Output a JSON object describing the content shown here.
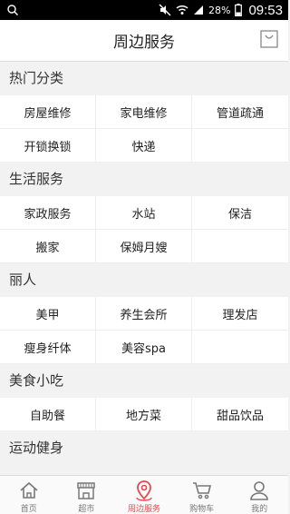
{
  "status_bar": {
    "battery": "28%",
    "time": "09:53"
  },
  "header": {
    "title": "周边服务"
  },
  "sections": [
    {
      "title": "热门分类",
      "rows": [
        [
          "房屋维修",
          "家电维修",
          "管道疏通"
        ],
        [
          "开锁换锁",
          "快递",
          ""
        ]
      ]
    },
    {
      "title": "生活服务",
      "rows": [
        [
          "家政服务",
          "水站",
          "保洁"
        ],
        [
          "搬家",
          "保姆月嫂",
          ""
        ]
      ]
    },
    {
      "title": "丽人",
      "rows": [
        [
          "美甲",
          "养生会所",
          "理发店"
        ],
        [
          "瘦身纤体",
          "美容spa",
          ""
        ]
      ]
    },
    {
      "title": "美食小吃",
      "rows": [
        [
          "自助餐",
          "地方菜",
          "甜品饮品"
        ]
      ]
    },
    {
      "title": "运动健身",
      "rows": []
    }
  ],
  "tabs": [
    {
      "label": "首页",
      "icon": "home-icon",
      "active": false
    },
    {
      "label": "超市",
      "icon": "store-icon",
      "active": false
    },
    {
      "label": "周边服务",
      "icon": "location-pin-icon",
      "active": true
    },
    {
      "label": "购物车",
      "icon": "cart-icon",
      "active": false
    },
    {
      "label": "我的",
      "icon": "person-icon",
      "active": false
    }
  ],
  "colors": {
    "accent": "#e8474d",
    "status_bar": "#000000",
    "background": "#f2f2f2"
  }
}
